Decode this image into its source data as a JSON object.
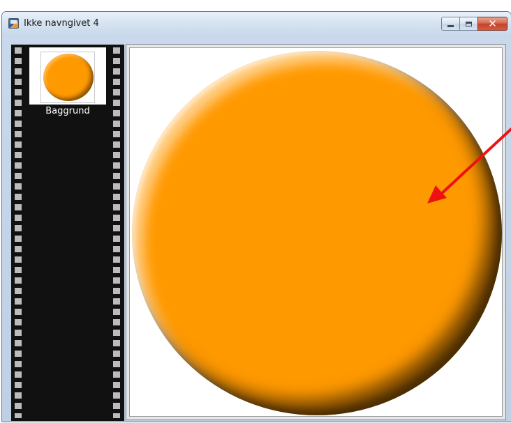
{
  "window": {
    "title": "Ikke navngivet 4",
    "buttons": {
      "minimize_icon": "minimize-icon",
      "maximize_icon": "maximize-icon",
      "close_glyph": "✕"
    }
  },
  "layers_panel": {
    "layers": [
      {
        "name": "Baggrund",
        "thumbnail": "orange-circle"
      }
    ]
  },
  "canvas": {
    "shape": "circle",
    "fill_color": "#ff9900",
    "background_color": "#ffffff"
  },
  "annotation": {
    "type": "arrow",
    "color": "#ee1111"
  }
}
